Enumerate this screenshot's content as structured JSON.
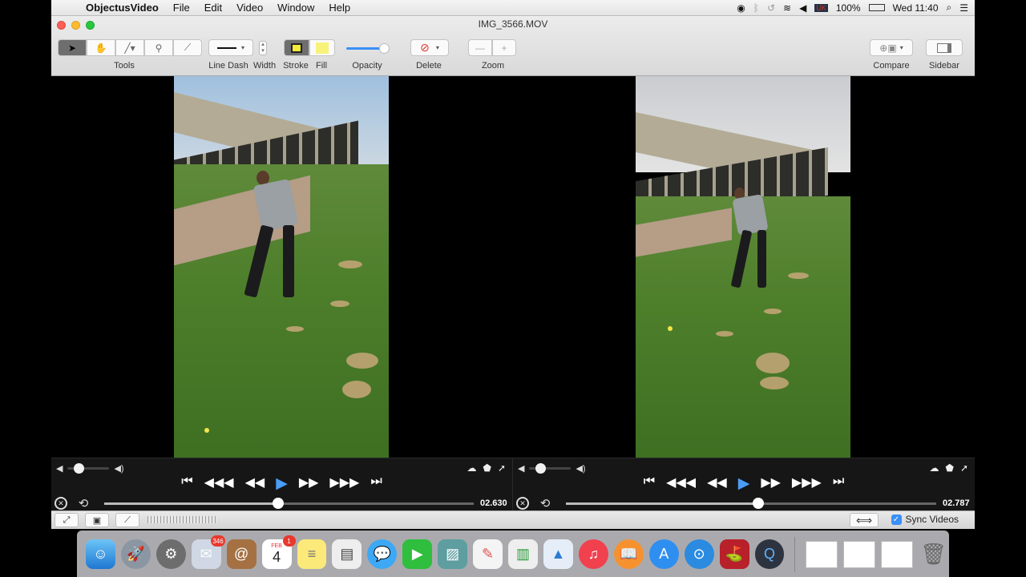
{
  "menubar": {
    "app_name": "ObjectusVideo",
    "menus": [
      "File",
      "Edit",
      "Video",
      "Window",
      "Help"
    ],
    "battery": "100%",
    "clock": "Wed 11:40"
  },
  "window": {
    "title": "IMG_3566.MOV"
  },
  "toolbar": {
    "tools_label": "Tools",
    "line_dash_label": "Line Dash",
    "width_label": "Width",
    "stroke_label": "Stroke",
    "fill_label": "Fill",
    "opacity_label": "Opacity",
    "delete_label": "Delete",
    "zoom_label": "Zoom",
    "compare_label": "Compare",
    "sidebar_label": "Sidebar",
    "stroke_color": "#f3ea3a",
    "fill_color": "#f8f27a",
    "opacity_level": 0.9
  },
  "players": {
    "left": {
      "timecode": "02.630",
      "position": 0.47,
      "volume": 0.15
    },
    "right": {
      "timecode": "02.787",
      "position": 0.52,
      "volume": 0.15
    }
  },
  "bottombar": {
    "sync_label": "Sync Videos",
    "sync_checked": true
  },
  "dock": {
    "mail_badge": "346",
    "calendar_badge": "1",
    "calendar_month": "FEB",
    "calendar_day": "4"
  },
  "colors": {
    "accent": "#4a9df8"
  }
}
